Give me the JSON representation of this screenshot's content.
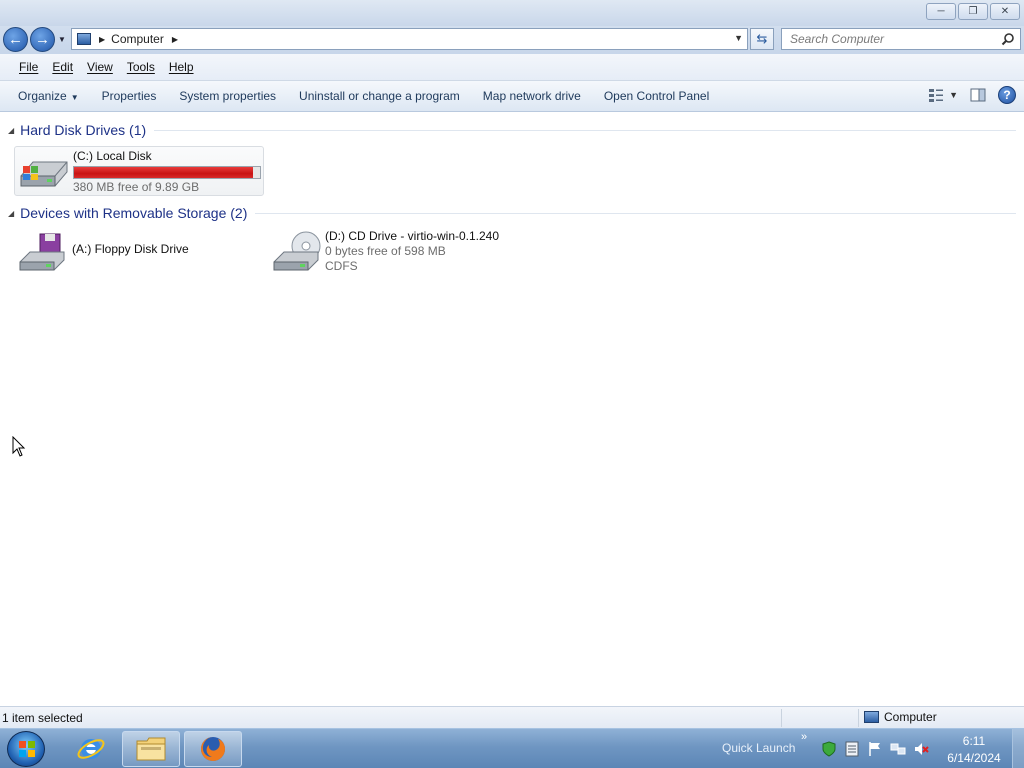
{
  "window": {
    "buttons": [
      "minimize-icon",
      "restore-icon",
      "close-icon"
    ]
  },
  "address": {
    "location": "Computer",
    "search_placeholder": "Search Computer"
  },
  "menu": {
    "items": [
      {
        "label": "File"
      },
      {
        "label": "Edit"
      },
      {
        "label": "View"
      },
      {
        "label": "Tools"
      },
      {
        "label": "Help"
      }
    ]
  },
  "commands": {
    "organize": "Organize",
    "properties": "Properties",
    "system_properties": "System properties",
    "uninstall": "Uninstall or change a program",
    "map_drive": "Map network drive",
    "control_panel": "Open Control Panel"
  },
  "groups": {
    "hard_disk": {
      "title": "Hard Disk Drives (1)",
      "drives": [
        {
          "name": "(C:) Local Disk",
          "detail": "380 MB free of 9.89 GB",
          "used_fraction": 0.962,
          "bar_color": "#d81c1c"
        }
      ]
    },
    "removable": {
      "title": "Devices with Removable Storage (2)",
      "drives": [
        {
          "name": "(A:) Floppy Disk Drive"
        },
        {
          "name": "(D:) CD Drive - virtio-win-0.1.240",
          "detail": "0 bytes free of 598 MB",
          "fs": "CDFS"
        }
      ]
    }
  },
  "status": {
    "selection": "1 item selected",
    "location": "Computer"
  },
  "taskbar": {
    "quick_launch": "Quick Launch",
    "time": "6:11",
    "date": "6/14/2024",
    "apps": [
      "internet-explorer-icon",
      "windows-explorer-icon",
      "firefox-icon"
    ]
  },
  "colors": {
    "accent": "#1e3287",
    "usage_bar": "#d81c1c",
    "taskbar": "#6f96c2"
  }
}
